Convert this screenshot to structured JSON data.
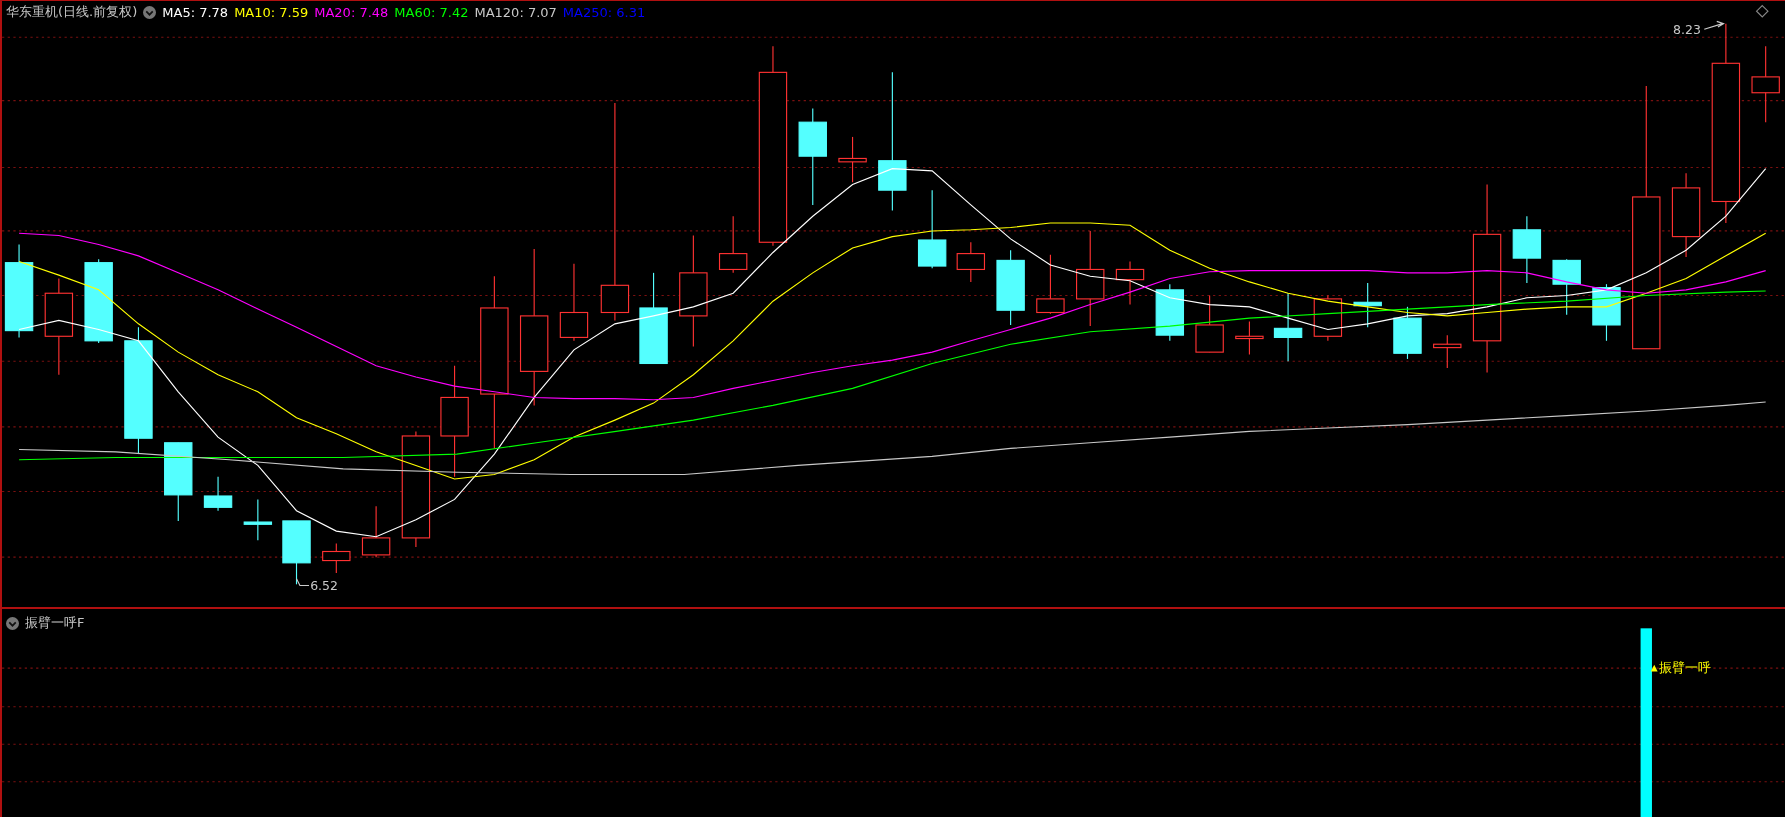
{
  "main_panel": {
    "title": "华东重机(日线.前复权)",
    "indicators": [
      {
        "label": "MA5: 7.78",
        "color": "#ffffff"
      },
      {
        "label": "MA10: 7.59",
        "color": "#ffff00"
      },
      {
        "label": "MA20: 7.48",
        "color": "#ff00ff"
      },
      {
        "label": "MA60: 7.42",
        "color": "#00ff00"
      },
      {
        "label": "MA120: 7.07",
        "color": "#c8c8c8"
      },
      {
        "label": "MA250: 6.31",
        "color": "#0000ff"
      }
    ],
    "high_label": "8.23",
    "low_label": "6.52"
  },
  "sub_panel": {
    "title": "振臂一呼F",
    "signal_label": "振臂一呼"
  }
}
